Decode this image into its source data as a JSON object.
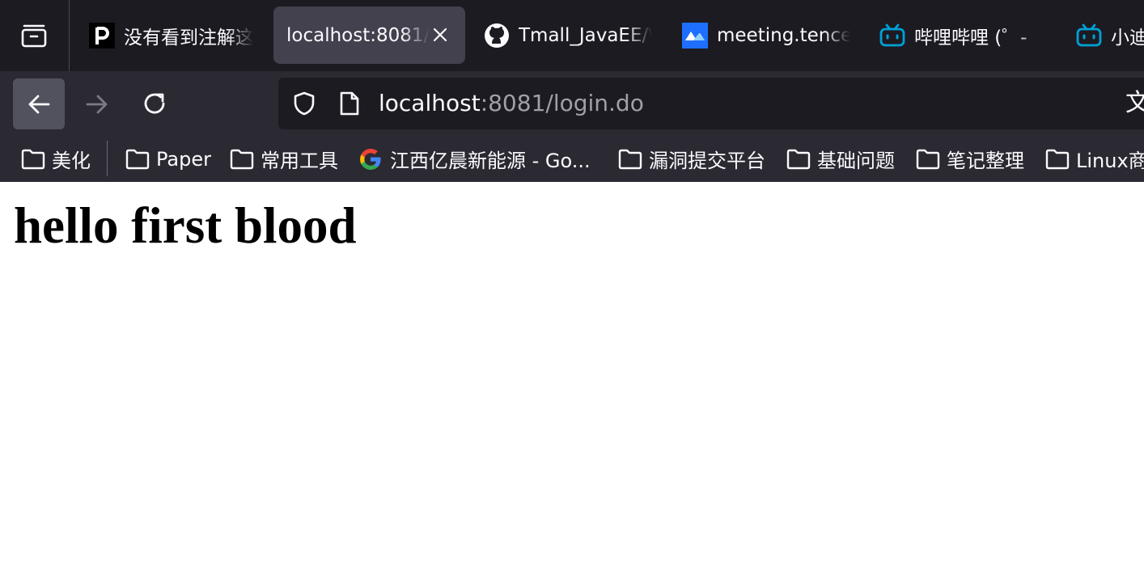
{
  "browser": {
    "tabs": [
      {
        "label": "没有看到注解这",
        "selected": false,
        "favicon": "p-letter-icon"
      },
      {
        "label": "localhost:8081/",
        "selected": true,
        "favicon": "none"
      },
      {
        "label": "Tmall_JavaEE/\\",
        "selected": false,
        "favicon": "github-icon"
      },
      {
        "label": "meeting.tence",
        "selected": false,
        "favicon": "tencent-meeting-icon"
      },
      {
        "label": "哔哩哔哩 (゜-",
        "selected": false,
        "favicon": "bilibili-icon"
      },
      {
        "label": "小迪",
        "selected": false,
        "favicon": "bilibili-icon"
      }
    ],
    "address": {
      "host": "localhost",
      "rest": ":8081/login.do",
      "extra": "文"
    },
    "bookmarks": [
      {
        "label": "美化",
        "icon": "folder-icon"
      },
      {
        "label": "Paper",
        "icon": "folder-icon"
      },
      {
        "label": "常用工具",
        "icon": "folder-icon"
      },
      {
        "label": "江西亿晨新能源 - Go...",
        "icon": "google-icon"
      },
      {
        "label": "漏洞提交平台",
        "icon": "folder-icon"
      },
      {
        "label": "基础问题",
        "icon": "folder-icon"
      },
      {
        "label": "笔记整理",
        "icon": "folder-icon"
      },
      {
        "label": "Linux商",
        "icon": "folder-icon"
      }
    ]
  },
  "page": {
    "heading": "hello first blood"
  },
  "colors": {
    "tabstrip_bg": "#1c1b22",
    "toolbar_bg": "#2b2a33",
    "selected_tab_bg": "#42414d",
    "url_text_dim": "#a0a0a8",
    "bilibili_blue": "#00a1d6",
    "tencent_meeting_blue": "#1e6fff"
  }
}
